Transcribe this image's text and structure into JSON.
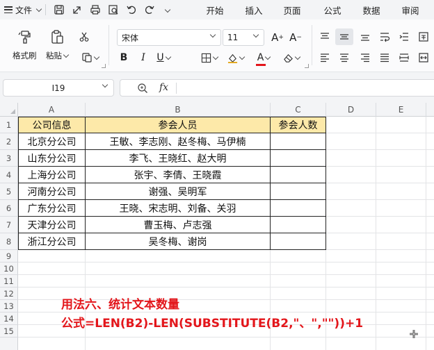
{
  "menubar": {
    "file_label": "文件",
    "tabs": [
      {
        "label": "开始",
        "active": true
      },
      {
        "label": "插入",
        "active": false
      },
      {
        "label": "页面",
        "active": false
      },
      {
        "label": "公式",
        "active": false
      },
      {
        "label": "数据",
        "active": false
      },
      {
        "label": "审阅",
        "active": false
      }
    ]
  },
  "ribbon": {
    "format_painter": "格式刷",
    "paste": "粘贴",
    "font_name": "宋体",
    "font_size": "11",
    "font_color": "#e3161b",
    "accent": "#107c41"
  },
  "formula_bar": {
    "name_box": "I19",
    "fx_label": "fx",
    "formula": ""
  },
  "sheet": {
    "columns": [
      "A",
      "B",
      "C",
      "D",
      "E"
    ],
    "rows": [
      "1",
      "2",
      "3",
      "4",
      "5",
      "6",
      "7",
      "8",
      "9",
      "10",
      "11",
      "12",
      "13",
      "14",
      "15"
    ],
    "header_fill": "#fde9a9",
    "table": {
      "headers": [
        "公司信息",
        "参会人员",
        "参会人数"
      ],
      "rows": [
        [
          "北京分公司",
          "王敏、李志刚、赵冬梅、马伊楠",
          ""
        ],
        [
          "山东分公司",
          "李飞、王晓红、赵大明",
          ""
        ],
        [
          "上海分公司",
          "张宇、李倩、王晓霞",
          ""
        ],
        [
          "河南分公司",
          "谢强、吴明军",
          ""
        ],
        [
          "广东分公司",
          "王晓、宋志明、刘备、关羽",
          ""
        ],
        [
          "天津分公司",
          "曹玉梅、卢志强",
          ""
        ],
        [
          "浙江分公司",
          "吴冬梅、谢岗",
          ""
        ]
      ]
    }
  },
  "annotation": {
    "line1": "用法六、统计文本数量",
    "line2": "公式=LEN(B2)-LEN(SUBSTITUTE(B2,\"、\",\"\"))+1",
    "color": "#e3161b"
  }
}
